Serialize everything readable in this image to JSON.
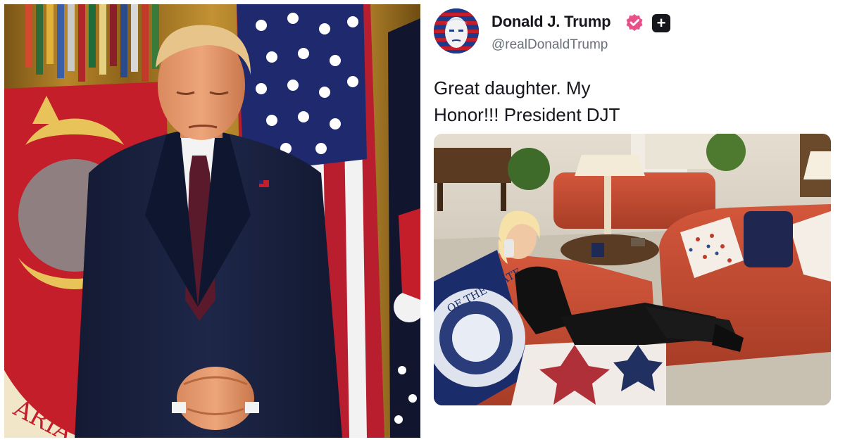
{
  "post": {
    "display_name": "Donald J. Trump",
    "handle": "@realDonaldTrump",
    "text_lines": [
      "Great daughter. My",
      "Honor!!! President DJT"
    ],
    "badges": {
      "verified_icon": "verified-check-icon",
      "plus_icon": "plus-badge-icon",
      "plus_glyph": "+"
    },
    "colors": {
      "verified": "#e8508a",
      "text": "#16161d",
      "handle": "#6b6f7a"
    }
  },
  "left_photo": {
    "seal_text": "ARIA"
  },
  "attached_photo": {
    "blanket_text": "OF THE STATE"
  }
}
